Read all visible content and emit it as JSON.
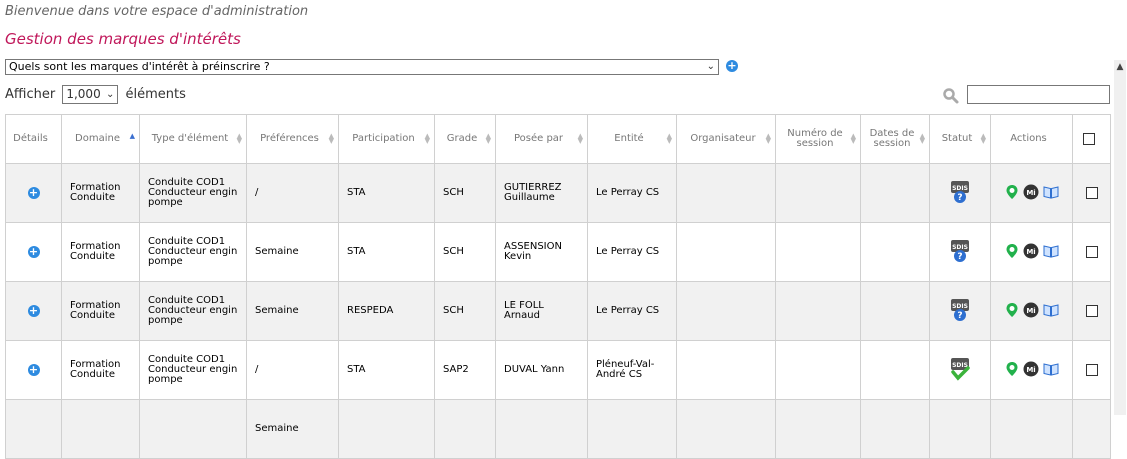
{
  "header": {
    "welcome": "Bienvenue dans votre espace d'administration",
    "title": "Gestion des marques d'intérêts"
  },
  "select": {
    "value": "Quels sont les marques d'intérêt à préinscrire ?"
  },
  "length": {
    "prefix": "Afficher",
    "value": "1,000",
    "suffix": "éléments"
  },
  "columns": [
    "Détails",
    "Domaine",
    "Type d'élément",
    "Préférences",
    "Participation",
    "Grade",
    "Posée par",
    "Entité",
    "Organisateur",
    "Numéro de session",
    "Dates de session",
    "Statut",
    "Actions"
  ],
  "rows": [
    {
      "domaine": "Formation Conduite",
      "type": "Conduite COD1 Conducteur engin pompe",
      "preferences": "/",
      "participation": "STA",
      "grade": "SCH",
      "posee_par": "GUTIERREZ Guillaume",
      "entite": "Le Perray CS",
      "organisateur": "",
      "numero": "",
      "dates": "",
      "statut": "sdis-pending-icon"
    },
    {
      "domaine": "Formation Conduite",
      "type": "Conduite COD1 Conducteur engin pompe",
      "preferences": "Semaine",
      "participation": "STA",
      "grade": "SCH",
      "posee_par": "ASSENSION Kevin",
      "entite": "Le Perray CS",
      "organisateur": "",
      "numero": "",
      "dates": "",
      "statut": "sdis-pending-icon"
    },
    {
      "domaine": "Formation Conduite",
      "type": "Conduite COD1 Conducteur engin pompe",
      "preferences": "Semaine",
      "participation": "RESPEDA",
      "grade": "SCH",
      "posee_par": "LE FOLL Arnaud",
      "entite": "Le Perray CS",
      "organisateur": "",
      "numero": "",
      "dates": "",
      "statut": "sdis-pending-icon"
    },
    {
      "domaine": "Formation Conduite",
      "type": "Conduite COD1 Conducteur engin pompe",
      "preferences": "/",
      "participation": "STA",
      "grade": "SAP2",
      "posee_par": "DUVAL Yann",
      "entite": "Pléneuf-Val-André CS",
      "organisateur": "",
      "numero": "",
      "dates": "",
      "statut": "sdis-approved-icon"
    },
    {
      "domaine": "",
      "type": "",
      "preferences": "Semaine",
      "participation": "",
      "grade": "",
      "posee_par": "",
      "entite": "",
      "organisateur": "",
      "numero": "",
      "dates": "",
      "statut": ""
    }
  ],
  "colors": {
    "title": "#c0175a",
    "accent": "#2e8be0",
    "pin": "#22b14c",
    "pending": "#2e6fd0",
    "approved": "#3bb33b"
  }
}
